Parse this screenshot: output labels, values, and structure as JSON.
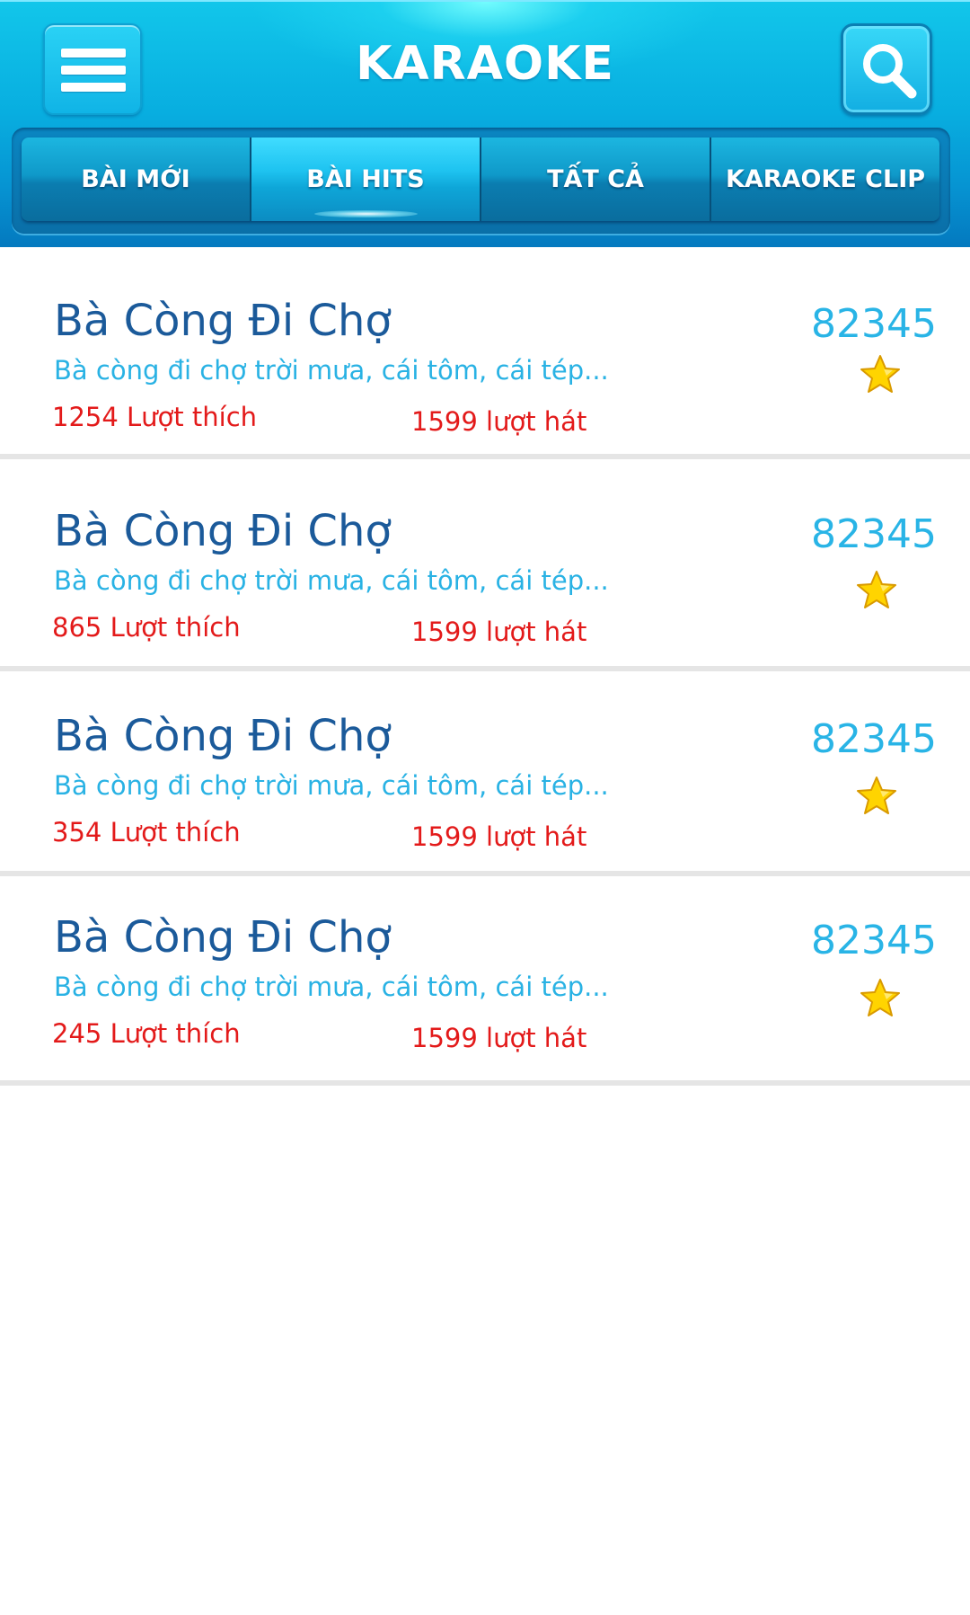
{
  "header": {
    "title": "KARAOKE",
    "menu_icon": "menu-icon",
    "search_icon": "search-icon"
  },
  "tabs": [
    {
      "label": "BÀI MỚI",
      "active": false
    },
    {
      "label": "BÀI HITS",
      "active": true
    },
    {
      "label": "TẤT CẢ",
      "active": false
    },
    {
      "label": "KARAOKE CLIP",
      "active": false
    }
  ],
  "songs": [
    {
      "title": "Bà Còng Đi Chợ",
      "lyrics": "Bà còng đi chợ trời mưa, cái tôm, cái tép...",
      "likes": "1254 Lượt thích",
      "plays": "1599 lượt hát",
      "code": "82345",
      "favorite_icon": "star-icon"
    },
    {
      "title": "Bà Còng Đi Chợ",
      "lyrics": "Bà còng đi chợ trời mưa, cái tôm, cái tép...",
      "likes": "865 Lượt thích",
      "plays": "1599 lượt hát",
      "code": "82345",
      "favorite_icon": "star-icon"
    },
    {
      "title": "Bà Còng Đi Chợ",
      "lyrics": "Bà còng đi chợ trời mưa, cái tôm, cái tép...",
      "likes": "354 Lượt thích",
      "plays": "1599 lượt hát",
      "code": "82345",
      "favorite_icon": "star-icon"
    },
    {
      "title": "Bà Còng Đi Chợ",
      "lyrics": "Bà còng đi chợ trời mưa, cái tôm, cái tép...",
      "likes": "245 Lượt thích",
      "plays": "1599 lượt hát",
      "code": "82345",
      "favorite_icon": "star-icon"
    }
  ],
  "colors": {
    "header_blue": "#08aee0",
    "title_blue": "#1b5a9a",
    "lyrics_blue": "#29b2e4",
    "count_red": "#e31a1a",
    "star_yellow": "#ffd400"
  }
}
